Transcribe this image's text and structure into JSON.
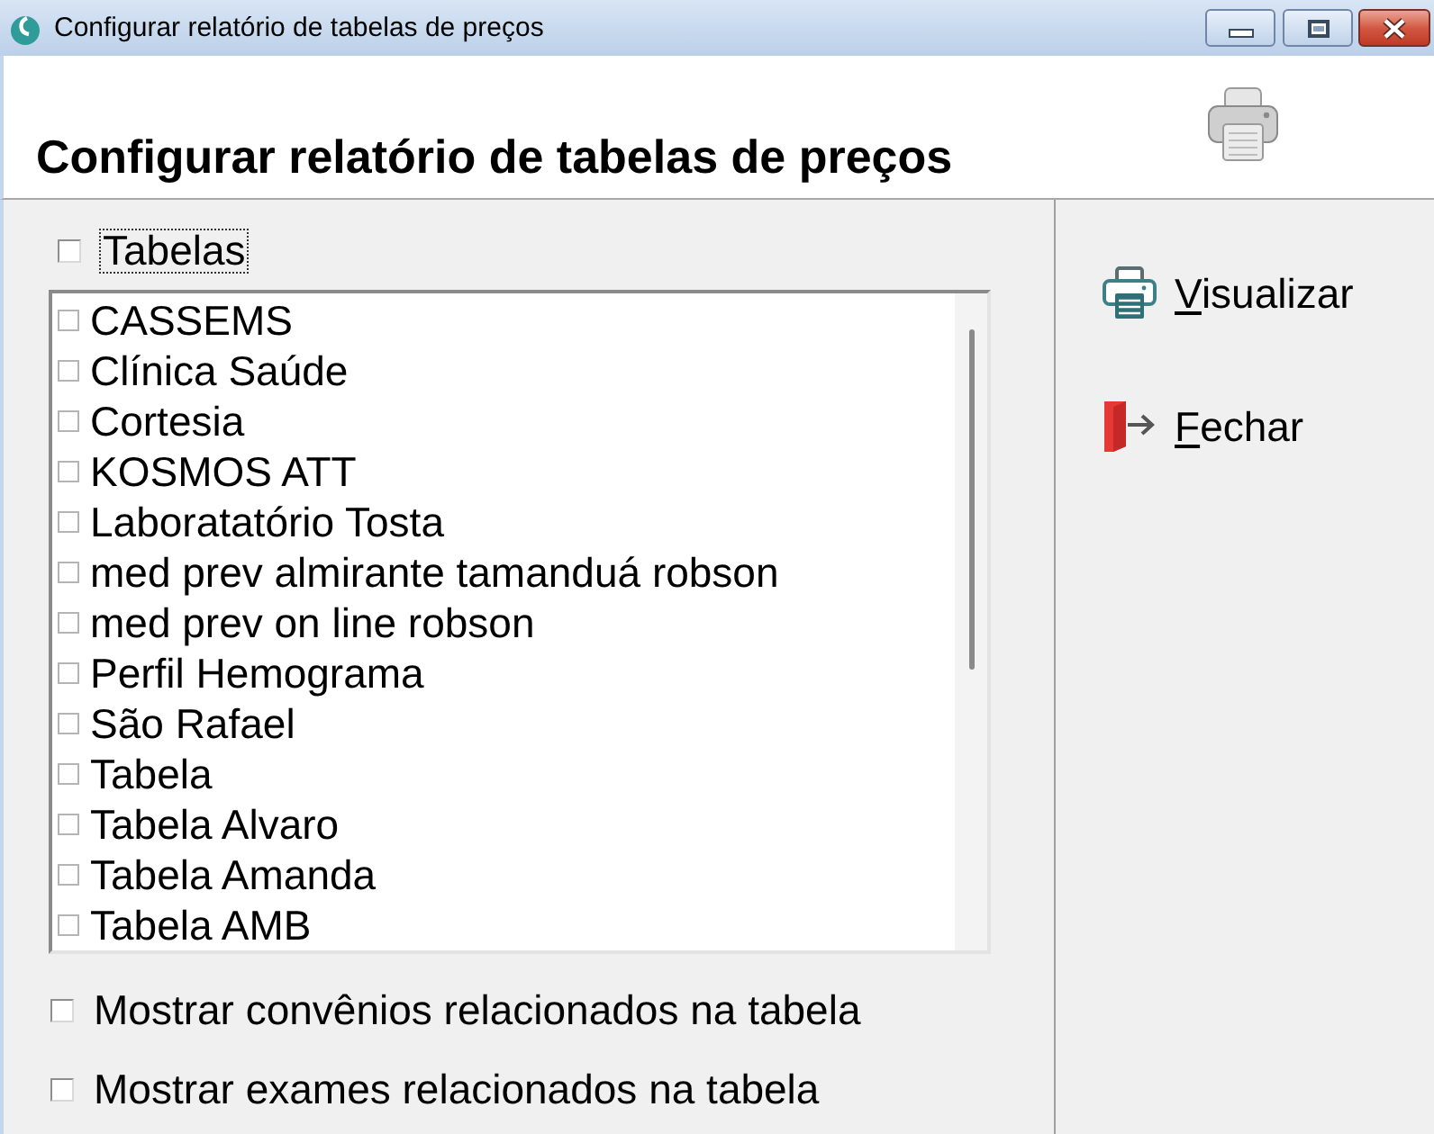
{
  "window": {
    "title": "Configurar relatório de tabelas de preços"
  },
  "header": {
    "title": "Configurar relatório de tabelas de preços"
  },
  "tables_toggle": {
    "label": "Tabelas",
    "checked": false,
    "focused": true
  },
  "tables_list": {
    "items": [
      {
        "label": "CASSEMS",
        "checked": false
      },
      {
        "label": "Clínica Saúde",
        "checked": false
      },
      {
        "label": "Cortesia",
        "checked": false
      },
      {
        "label": "KOSMOS ATT",
        "checked": false
      },
      {
        "label": "Laboratatório Tosta",
        "checked": false
      },
      {
        "label": "med prev almirante tamanduá robson",
        "checked": false
      },
      {
        "label": "med prev on line robson",
        "checked": false
      },
      {
        "label": "Perfil Hemograma",
        "checked": false
      },
      {
        "label": "São Rafael",
        "checked": false
      },
      {
        "label": "Tabela",
        "checked": false
      },
      {
        "label": "Tabela Alvaro",
        "checked": false
      },
      {
        "label": "Tabela Amanda",
        "checked": false
      },
      {
        "label": "Tabela AMB",
        "checked": false
      }
    ]
  },
  "options": [
    {
      "label": "Mostrar convênios relacionados na tabela",
      "checked": false
    },
    {
      "label": "Mostrar exames relacionados na tabela",
      "checked": false
    }
  ],
  "actions": [
    {
      "kind": "preview",
      "label": "Visualizar"
    },
    {
      "kind": "close",
      "label": "Fechar"
    }
  ]
}
